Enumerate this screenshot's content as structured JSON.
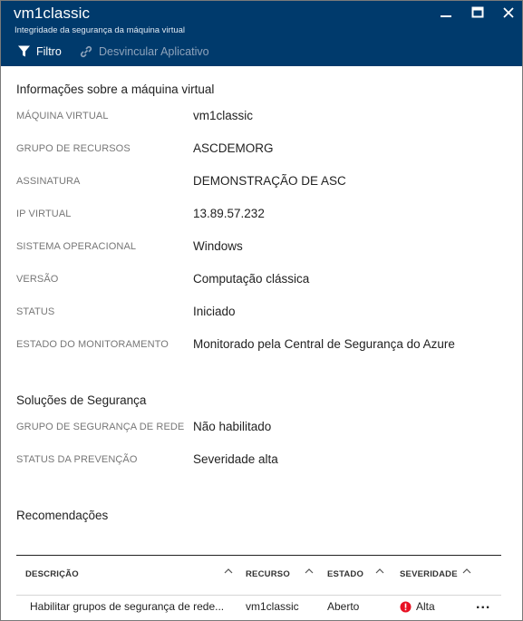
{
  "window": {
    "title": "vm1classic",
    "subtitle": "Integridade da segurança da máquina virtual",
    "header_color": "#003a6c"
  },
  "toolbar": {
    "filter_label": "Filtro",
    "unlink_label": "Desvincular Aplicativo"
  },
  "vm_info": {
    "heading": "Informações sobre a máquina virtual",
    "rows": [
      {
        "label": "MÁQUINA VIRTUAL",
        "value": "vm1classic"
      },
      {
        "label": "GRUPO DE RECURSOS",
        "value": "ASCDEMORG"
      },
      {
        "label": "ASSINATURA",
        "value": "DEMONSTRAÇÃO DE ASC"
      },
      {
        "label": "IP VIRTUAL",
        "value": "13.89.57.232"
      },
      {
        "label": "SISTEMA OPERACIONAL",
        "value": "Windows"
      },
      {
        "label": "VERSÃO",
        "value": "Computação clássica"
      },
      {
        "label": "STATUS",
        "value": "Iniciado"
      },
      {
        "label": "ESTADO DO MONITORAMENTO",
        "value": "Monitorado pela Central de Segurança do Azure"
      }
    ]
  },
  "security_solutions": {
    "heading": "Soluções de Segurança",
    "rows": [
      {
        "label": "GRUPO DE SEGURANÇA DE REDE",
        "value": "Não habilitado"
      },
      {
        "label": "STATUS DA PREVENÇÃO",
        "value": "Severidade alta"
      }
    ]
  },
  "recommendations": {
    "heading": "Recomendações",
    "columns": [
      "DESCRIÇÃO",
      "RECURSO",
      "ESTADO",
      "SEVERIDADE"
    ],
    "rows": [
      {
        "description": "Habilitar grupos de segurança de rede...",
        "resource": "vm1classic",
        "state": "Aberto",
        "severity": "Alta",
        "severity_icon": "error-icon",
        "severity_color": "#e81123",
        "more": "..."
      }
    ]
  }
}
